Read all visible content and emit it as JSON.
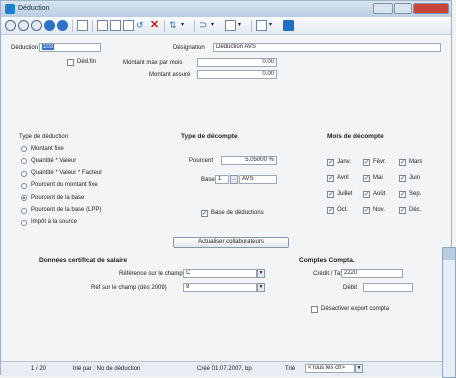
{
  "window": {
    "title": "Déduction"
  },
  "toolbar": {
    "icons": [
      "first-record-icon",
      "previous-record-icon",
      "stop-icon",
      "next-record-icon",
      "last-record-icon",
      "table-icon",
      "new-icon",
      "copy-icon",
      "save-icon",
      "undo-icon",
      "delete-icon",
      "sort-icon",
      "filter-icon",
      "report-icon",
      "print-icon",
      "help-icon"
    ]
  },
  "header": {
    "deduction_label": "Déduction",
    "deduction_value": "103",
    "designation_label": "Désignation",
    "designation_value": "Déduction AVS",
    "deduction_flag_label": "Déd.fin",
    "amount_max_label": "Montant max par mois",
    "amount_max_value": "0.00",
    "amount_insured_label": "Montant assuré",
    "amount_insured_value": "0.00"
  },
  "type_deduction": {
    "title": "Type de déduction",
    "options": [
      "Montant fixe",
      "Quantité * Valeur",
      "Quantité * Valeur * Facteur",
      "Pourcent du montant fixe",
      "Pourcent de la base",
      "Pourcent de la base (LPP)",
      "Impôt à la source"
    ],
    "selected_index": 4
  },
  "type_decompte": {
    "title": "Type de décompte",
    "percent_label": "Pourcent",
    "percent_value": "5.05000 %",
    "base_label": "Base",
    "base_value": "1",
    "base_name": "AVS",
    "base_deductions_label": "Base de déductions",
    "update_button": "Actualiser collaborateurs"
  },
  "mois": {
    "title": "Mois de décompte",
    "months": [
      "Janv.",
      "Févr.",
      "Mars",
      "Avril",
      "Mai",
      "Juin",
      "Juillet",
      "Août",
      "Sep.",
      "Oct.",
      "Nov.",
      "Déc."
    ]
  },
  "certificat": {
    "title": "Données certificat de salaire",
    "ref_label": "Référence sur le champ",
    "ref_value": "C",
    "ref2_label": "Réf sur le champ (dès 2009)",
    "ref2_value": "9"
  },
  "comptes": {
    "title": "Comptes Compta.",
    "credit_label": "Crédit / Taxe",
    "credit_value": "2220",
    "debit_label": "Débit",
    "debit_value": "",
    "export_label": "Désactiver export compta"
  },
  "status": {
    "record": "1 / 20",
    "sort": "trié par : No de déduction",
    "created": "Créé 01.07.2007, bp",
    "sort_label": "Trié",
    "filter_value": "<Tous les ch>"
  },
  "colors": {
    "accent": "#1f7fcf",
    "titlebar": "#b9cde2"
  }
}
